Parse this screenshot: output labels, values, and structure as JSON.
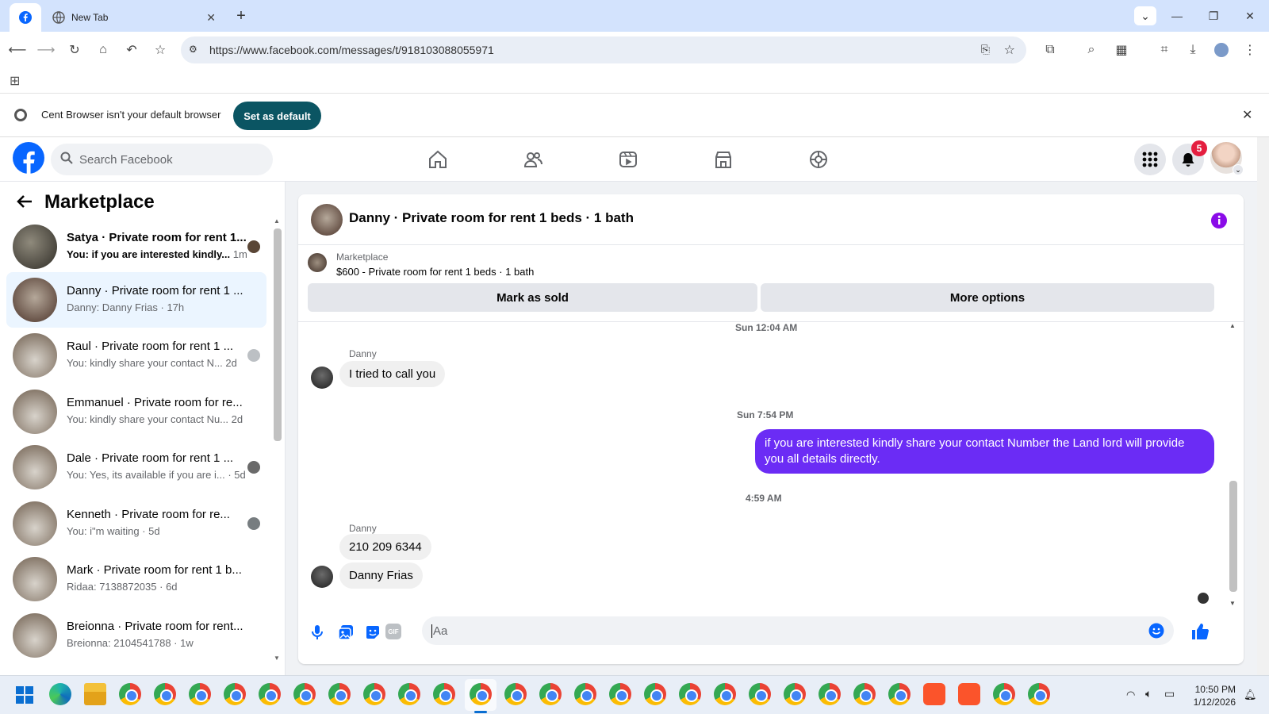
{
  "browser": {
    "tabs": [
      {
        "label": "",
        "icon": "facebook-icon",
        "active": true
      },
      {
        "label": "New Tab",
        "icon": "globe-icon",
        "active": false
      }
    ],
    "url": "https://www.facebook.com/messages/t/918103088055971",
    "infobar": {
      "message": "Cent Browser isn't your default browser",
      "button": "Set as default"
    }
  },
  "facebook": {
    "search_placeholder": "Search Facebook",
    "notification_count": "5",
    "brand_color": "#0866ff"
  },
  "sidebar": {
    "title": "Marketplace",
    "conversations": [
      {
        "title": "Satya · Private room for rent 1...",
        "preview": "You: if you are interested kindly...",
        "time": "1m"
      },
      {
        "title": "Danny · Private room for rent 1 ...",
        "preview": "Danny: Danny Frias",
        "time": "17h"
      },
      {
        "title": "Raul · Private room for rent 1 ...",
        "preview": "You: kindly share your contact N...",
        "time": "2d"
      },
      {
        "title": "Emmanuel · Private room for re...",
        "preview": "You: kindly share your contact Nu...",
        "time": "2d"
      },
      {
        "title": "Dale · Private room for rent 1 ...",
        "preview": "You: Yes, its available if you are i...",
        "time": "5d"
      },
      {
        "title": "Kenneth · Private room for re...",
        "preview": "You: i\"m waiting",
        "time": "5d"
      },
      {
        "title": "Mark · Private room for rent 1 b...",
        "preview": "Ridaa: 7138872035",
        "time": "6d"
      },
      {
        "title": "Breionna · Private room for rent...",
        "preview": "Breionna: 2104541788",
        "time": "1w"
      }
    ]
  },
  "chat": {
    "title": "Danny · Private room for rent 1 beds · 1 bath",
    "listing": {
      "source": "Marketplace",
      "summary": "$600 - Private room for rent 1 beds · 1 bath",
      "mark_sold": "Mark as sold",
      "more_options": "More options"
    },
    "timestamps": [
      "Sun 12:04 AM",
      "Sun 7:54 PM",
      "4:59 AM"
    ],
    "messages": {
      "sender1": "Danny",
      "m1": "I tried to call you",
      "m2": "if you are interested kindly share your contact Number the Land lord will provide you all details directly.",
      "sender2": "Danny",
      "m3": "210 209 6344",
      "m4": "Danny Frias"
    },
    "composer_placeholder": "Aa",
    "outgoing_color": "#6b2cf5"
  },
  "taskbar": {
    "time": "10:50 PM",
    "date": "1/12/2026"
  }
}
